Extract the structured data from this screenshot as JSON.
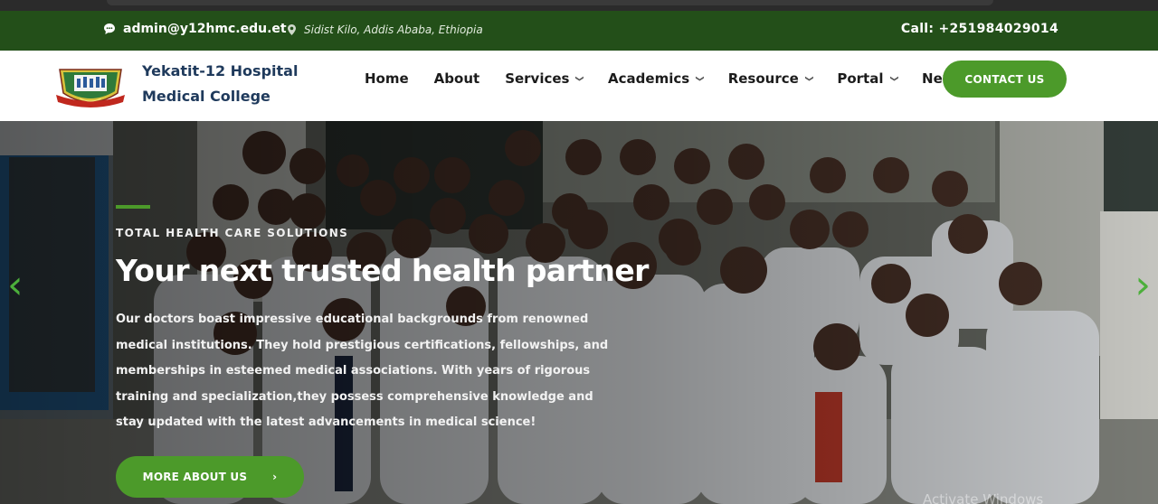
{
  "topbar": {
    "email": "admin@y12hmc.edu.et",
    "email_icon": "chat-bubble-icon",
    "address": "Sidist Kilo, Addis Ababa, Ethiopia",
    "address_icon": "map-pin-icon",
    "call": "Call: +251984029014"
  },
  "navbar": {
    "brand_line1": "Yekatit-12 Hospital",
    "brand_line2": "Medical College",
    "menu": [
      {
        "label": "Home",
        "dropdown": false
      },
      {
        "label": "About",
        "dropdown": false
      },
      {
        "label": "Services",
        "dropdown": true
      },
      {
        "label": "Academics",
        "dropdown": true
      },
      {
        "label": "Resource",
        "dropdown": true
      },
      {
        "label": "Portal",
        "dropdown": true
      },
      {
        "label": "News",
        "dropdown": true
      }
    ],
    "contact_label": "CONTACT US"
  },
  "hero": {
    "kicker": "TOTAL HEALTH CARE SOLUTIONS",
    "headline": "Your next trusted health partner",
    "body": "Our doctors boast impressive educational backgrounds from renowned medical institutions. They hold prestigious certifications, fellowships, and memberships in esteemed medical associations. With years of rigorous training and specialization,they possess comprehensive knowledge and stay updated with the latest advancements in medical science!",
    "button_label": "MORE ABOUT US",
    "button_arrow": "›",
    "prev_arrow": "‹",
    "next_arrow": "›",
    "overlay_text": "Activate Windows"
  },
  "colors": {
    "topbar_bg": "#234f19",
    "accent_green": "#4c9a2a",
    "brand_navy": "#1f3a5c"
  }
}
